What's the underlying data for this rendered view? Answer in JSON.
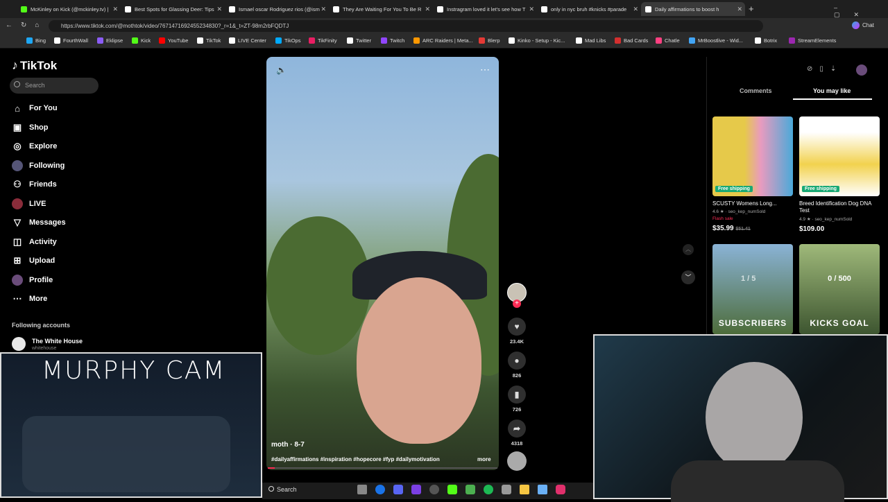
{
  "tabs": [
    {
      "label": "McKinley on Kick (@mckinley.tv) |",
      "color": "#53fc18"
    },
    {
      "label": "Best Spots for Glassing Deer: Tips",
      "color": "#e0e0e0"
    },
    {
      "label": "Ismael oscar Rodriguez rios (@ism",
      "color": "#e0e0e0"
    },
    {
      "label": "They Are Waiting For You To Be R",
      "color": "#e0e0e0"
    },
    {
      "label": "Instragram loved it let's see how T",
      "color": "#e0e0e0"
    },
    {
      "label": "only in nyc bruh #knicks #parade",
      "color": "#e0e0e0"
    },
    {
      "label": "Daily affirmations to boost h",
      "color": "#e0e0e0"
    }
  ],
  "url": "https://www.tiktok.com/@mothtok/video/7671471692455234830?_r=1&_t=ZT-98m2rbFQDTJ",
  "bookmarks": [
    "Bing",
    "FourthWall",
    "Eklipse",
    "Kick",
    "YouTube",
    "TikTok",
    "LIVE Center",
    "TikOps",
    "TikFinity",
    "Twitter",
    "Twitch",
    "ARC Raiders | Meta...",
    "Blerp",
    "Kinko - Setup - Kic...",
    "Mad Libs",
    "Bad Cards",
    "Chatle",
    "MrBoostlive - Wid...",
    "Botrix",
    "StreamElements"
  ],
  "tiktok": {
    "logo": "TikTok",
    "search_placeholder": "Search",
    "nav": [
      "For You",
      "Shop",
      "Explore",
      "Following",
      "Friends",
      "LIVE",
      "Messages",
      "Activity",
      "Upload",
      "Profile",
      "More"
    ],
    "following_header": "Following accounts",
    "following": {
      "name": "The White House",
      "handle": "whitehouse"
    }
  },
  "video": {
    "author": "moth · 8-7",
    "caption": "#dailyaffirmations #inspiration #hopecore #fyp #dailymotivation",
    "more": "more",
    "likes": "23.4K",
    "comments": "826",
    "saves": "726",
    "shares": "4318"
  },
  "right_panel": {
    "tabs": [
      "Comments",
      "You may like"
    ],
    "products": [
      {
        "title": "SCUSTY Womens Long...",
        "rating": "4.6 ★ · seo_kep_numSold",
        "flash": "Flash sale",
        "price": "$35.99",
        "old": "$51.41",
        "badge": "Free shipping"
      },
      {
        "title": "Breed Identification Dog DNA Test",
        "rating": "4.9 ★ · seo_kep_numSold",
        "flash": "",
        "price": "$109.00",
        "old": "",
        "badge": "Free shipping"
      }
    ],
    "overlays": [
      "1 / 5",
      "SUBSCRIBERS",
      "0 / 500",
      "KICKS GOAL"
    ]
  },
  "murphy_cam": "MURPHY CAM",
  "taskbar": {
    "search": "Search"
  },
  "chrome_right": {
    "chat": "Chat"
  }
}
